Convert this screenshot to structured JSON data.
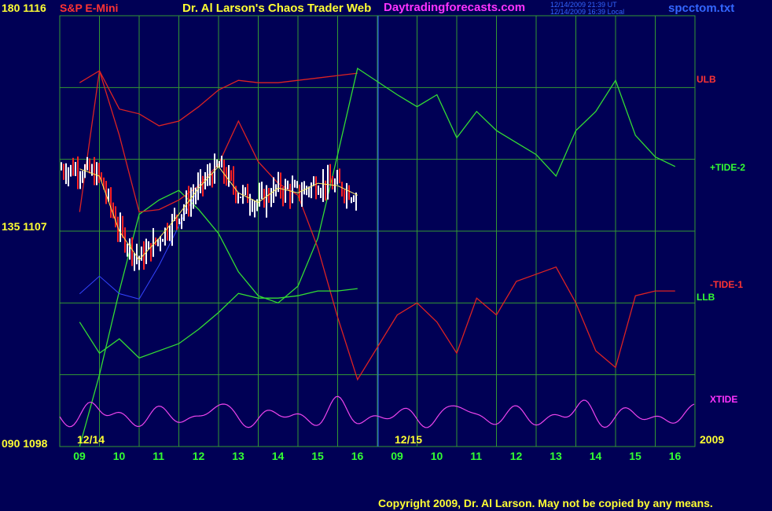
{
  "header": {
    "symbol": "S&P E-Mini",
    "title": "Dr. Al Larson's Chaos Trader Web",
    "site": "Daytradingforecasts.com",
    "stamp_ut": "12/14/2009 21:39 UT",
    "stamp_local": "12/14/2009 16:39 Local",
    "file": "spcctom.txt"
  },
  "y_axis": {
    "top_label": "180 1116",
    "mid_label": "135 1107",
    "bottom_label": "090 1098"
  },
  "x_axis": {
    "day1_label": "12/14",
    "day2_label": "12/15",
    "year_label": "2009",
    "hours": [
      "09",
      "10",
      "11",
      "12",
      "13",
      "14",
      "15",
      "16",
      "09",
      "10",
      "11",
      "12",
      "13",
      "14",
      "15",
      "16"
    ]
  },
  "legend": {
    "ulb": "ULB",
    "tide2": "+TIDE-2",
    "tide1": "-TIDE-1",
    "llb": "LLB",
    "xtide": "XTIDE"
  },
  "footer": {
    "copyright": "Copyright 2009, Dr. Al Larson. May not be copied by any means."
  },
  "colors": {
    "background": "#000055",
    "grid": "#339933",
    "price_up": "#ffffff",
    "price_down": "#ff2222",
    "tide_plus": "#33dd33",
    "tide_minus": "#dd2222",
    "xtide": "#ee44ee",
    "moving_avg_fast": "#ffee55",
    "moving_avg_slow": "#3344ff",
    "divider": "#3366ff"
  },
  "chart_data": {
    "type": "line",
    "title": "S&P E-Mini",
    "y_scale_labels": [
      "180 1116",
      "135 1107",
      "090 1098"
    ],
    "x_hours": [
      "09",
      "10",
      "11",
      "12",
      "13",
      "14",
      "15",
      "16",
      "09",
      "10",
      "11",
      "12",
      "13",
      "14",
      "15",
      "16"
    ],
    "series": [
      {
        "name": "ULB",
        "x": [
          "09:00",
          "09:30",
          "10:00",
          "10:30",
          "11:00",
          "11:30",
          "12:00",
          "12:30",
          "13:00",
          "13:30",
          "14:00",
          "14:30",
          "15:00",
          "15:30",
          "16:00"
        ],
        "values": [
          1113.2,
          1113.7,
          1112.1,
          1111.9,
          1111.4,
          1111.6,
          1112.2,
          1112.9,
          1113.3,
          1113.2,
          1113.2,
          1113.3,
          1113.4,
          1113.5,
          1113.6
        ]
      },
      {
        "name": "+TIDE-2",
        "x": [
          "09:00",
          "09:30",
          "10:00",
          "10:30",
          "11:00",
          "11:30",
          "12:00",
          "12:30",
          "13:00",
          "13:30",
          "14:00",
          "14:30",
          "15:00",
          "15:30",
          "16:00",
          "09:00",
          "09:30",
          "10:00",
          "10:30",
          "11:00",
          "11:30",
          "12:00",
          "12:30",
          "13:00",
          "13:30",
          "14:00",
          "14:30",
          "15:00",
          "15:30",
          "16:00"
        ],
        "values": [
          1098.0,
          1101.0,
          1104.5,
          1107.7,
          1108.3,
          1108.7,
          1107.9,
          1106.9,
          1105.3,
          1104.3,
          1104.0,
          1104.7,
          1106.7,
          1110.2,
          1113.8,
          1112.7,
          1112.2,
          1112.7,
          1110.9,
          1112.0,
          1111.2,
          1110.7,
          1110.2,
          1109.3,
          1111.2,
          1112.0,
          1113.3,
          1111.0,
          1110.1,
          1109.7
        ]
      },
      {
        "name": "-TIDE-1",
        "x": [
          "09:00",
          "09:30",
          "10:00",
          "10:30",
          "11:00",
          "11:30",
          "12:00",
          "12:30",
          "13:00",
          "13:30",
          "14:00",
          "14:30",
          "15:00",
          "15:30",
          "16:00",
          "09:00",
          "09:30",
          "10:00",
          "10:30",
          "11:00",
          "11:30",
          "12:00",
          "12:30",
          "13:00",
          "13:30",
          "14:00",
          "14:30",
          "15:00",
          "15:30",
          "16:00"
        ],
        "values": [
          1107.8,
          1113.7,
          1111.0,
          1107.8,
          1107.9,
          1108.3,
          1108.9,
          1109.8,
          1111.6,
          1109.9,
          1109.0,
          1108.5,
          1106.3,
          1103.4,
          1100.8,
          1103.5,
          1104.0,
          1103.2,
          1101.9,
          1104.2,
          1103.5,
          1104.9,
          1105.2,
          1105.5,
          1104.0,
          1102.0,
          1101.3,
          1104.3,
          1104.5,
          1104.5
        ]
      },
      {
        "name": "LLB",
        "x": [
          "09:00",
          "09:30",
          "10:00",
          "10:30",
          "11:00",
          "11:30",
          "12:00",
          "12:30",
          "13:00",
          "13:30",
          "14:00",
          "14:30",
          "15:00",
          "15:30",
          "16:00"
        ],
        "values": [
          1103.2,
          1101.9,
          1102.5,
          1101.7,
          1102.0,
          1102.3,
          1102.9,
          1103.6,
          1104.4,
          1104.2,
          1104.2,
          1104.3,
          1104.5,
          1104.5,
          1104.6
        ]
      },
      {
        "name": "Price",
        "x": [
          "09:00",
          "09:30",
          "10:00",
          "10:30",
          "11:00",
          "11:30",
          "12:00",
          "12:30",
          "13:00",
          "13:30",
          "14:00",
          "14:30",
          "15:00",
          "15:30",
          "16:00"
        ],
        "values": [
          1109.6,
          1109.3,
          1107.0,
          1105.8,
          1106.7,
          1107.7,
          1108.8,
          1109.7,
          1108.6,
          1108.2,
          1108.8,
          1108.6,
          1109.0,
          1108.9,
          1108.5
        ]
      }
    ],
    "ylim": [
      1098,
      1116
    ]
  }
}
